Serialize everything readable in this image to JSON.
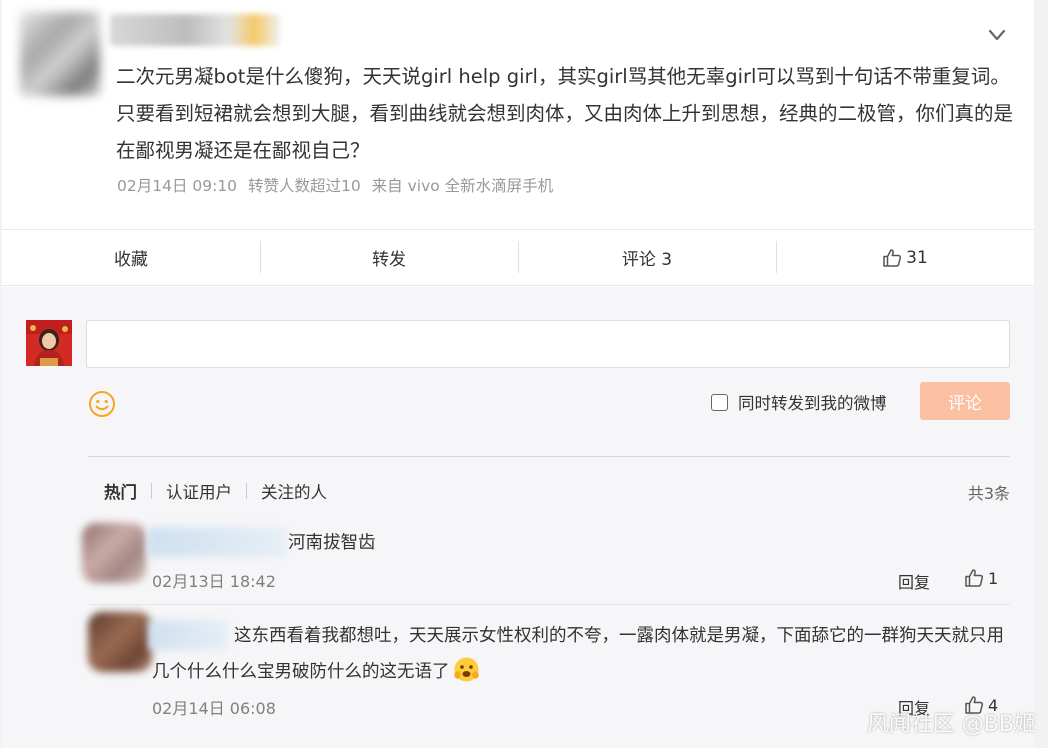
{
  "post": {
    "text": "二次元男凝bot是什么傻狗，天天说girl help girl，其实girl骂其他无辜girl可以骂到十句话不带重复词。只要看到短裙就会想到大腿，看到曲线就会想到肉体，又由肉体上升到思想，经典的二极管，你们真的是在鄙视男凝还是在鄙视自己？",
    "date": "02月14日 09:10",
    "repost_note": "转赞人数超过10",
    "source": "来自 vivo 全新水滴屏手机"
  },
  "actions": {
    "favorite": "收藏",
    "repost": "转发",
    "comment": "评论 3",
    "like_count": "31"
  },
  "composer": {
    "placeholder": "",
    "forward_label": "同时转发到我的微博",
    "submit_label": "评论"
  },
  "filters": {
    "tabs": [
      "热门",
      "认证用户",
      "关注的人"
    ],
    "total": "共3条"
  },
  "comments": [
    {
      "text": "河南拔智齿",
      "date": "02月13日 18:42",
      "reply": "回复",
      "likes": "1"
    },
    {
      "text": "这东西看着我都想吐，天天展示女性权利的不夸，一露肉体就是男凝，下面舔它的一群狗天天就只用几个什么什么宝男破防什么的这无语了",
      "date": "02月14日 06:08",
      "reply": "回复",
      "likes": "4"
    }
  ],
  "watermark": "风闻社区 @BB姬",
  "icons": {
    "more": "chevron-down-icon",
    "like": "thumbs-up-icon",
    "emoji": "smiley-icon",
    "emoji_inline": "hugging-face-emoji"
  },
  "colors": {
    "submit_bg": "#fbbfa1",
    "smiley": "#f5a623",
    "meta_gray": "#999999"
  }
}
